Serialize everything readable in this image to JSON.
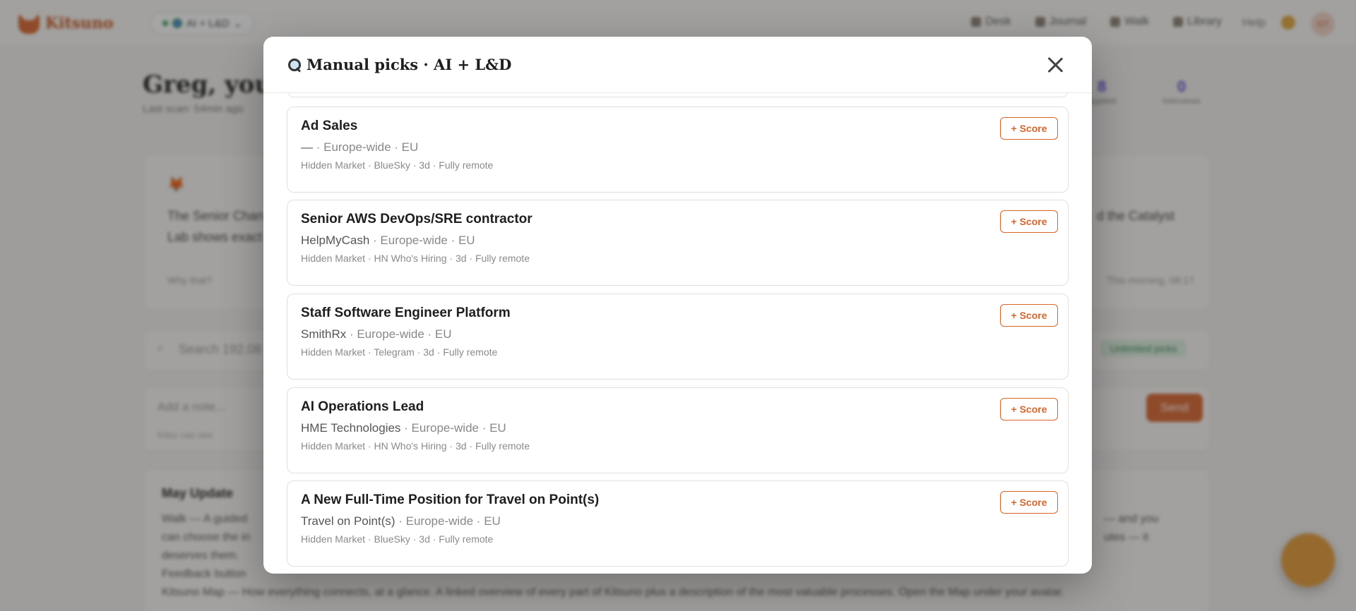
{
  "app": {
    "logo_text": "Kitsuno",
    "workspace": "AI + L&D",
    "nav": [
      "Desk",
      "Journal",
      "Walk",
      "Library"
    ],
    "help": "Help",
    "avatar_initials": "GT",
    "greeting": "Greg, your",
    "last_scan": "Last scan: 54min ago",
    "stats": [
      {
        "value": "8",
        "label": "Applied"
      },
      {
        "value": "0",
        "label": "Interviews"
      }
    ],
    "kitsu_card": {
      "line1_left": "The Senior Chan",
      "line2_left": "Lab shows exact",
      "line1_right": "d the Catalyst",
      "why": "Why that?",
      "time": "This morning, 08:17"
    },
    "search_placeholder": "Search 192,08",
    "unlimited_badge": "Unlimited picks",
    "note_placeholder": "Add a note...",
    "kitsu_can_see": "Kitsu can see",
    "send_label": "Send",
    "update": {
      "title": "May Update",
      "line1": "Walk — A guided",
      "line1_right": "— and you",
      "line2": "can choose the in",
      "line2_right": "utes — it",
      "line3": "deserves them.",
      "line4": "Feedback button",
      "line5": "Kitsuno Map — How everything connects, at a glance. A linked overview of every part of Kitsuno plus a description of the most valuable processes. Open the Map under your avatar."
    }
  },
  "modal": {
    "title": "Manual picks · AI + L&D",
    "score_label": "+ Score",
    "jobs": [
      {
        "title": "Ad Sales",
        "company": "—",
        "location": " · Europe-wide · EU",
        "meta": "Hidden Market · BlueSky · 3d · Fully remote"
      },
      {
        "title": "Senior AWS DevOps/SRE contractor",
        "company": "HelpMyCash",
        "location": " · Europe-wide · EU",
        "meta": "Hidden Market · HN Who's Hiring · 3d · Fully remote"
      },
      {
        "title": "Staff Software Engineer Platform",
        "company": "SmithRx",
        "location": " · Europe-wide · EU",
        "meta": "Hidden Market · Telegram · 3d · Fully remote"
      },
      {
        "title": "AI Operations Lead",
        "company": "HME Technologies",
        "location": " · Europe-wide · EU",
        "meta": "Hidden Market · HN Who's Hiring · 3d · Fully remote"
      },
      {
        "title": "A New Full-Time Position for Travel on Point(s)",
        "company": "Travel on Point(s)",
        "location": " · Europe-wide · EU",
        "meta": "Hidden Market · BlueSky · 3d · Fully remote"
      }
    ]
  },
  "colors": {
    "accent": "#d9642a",
    "stat_purple": "#5b4ad0",
    "success": "#3a8a4d"
  }
}
